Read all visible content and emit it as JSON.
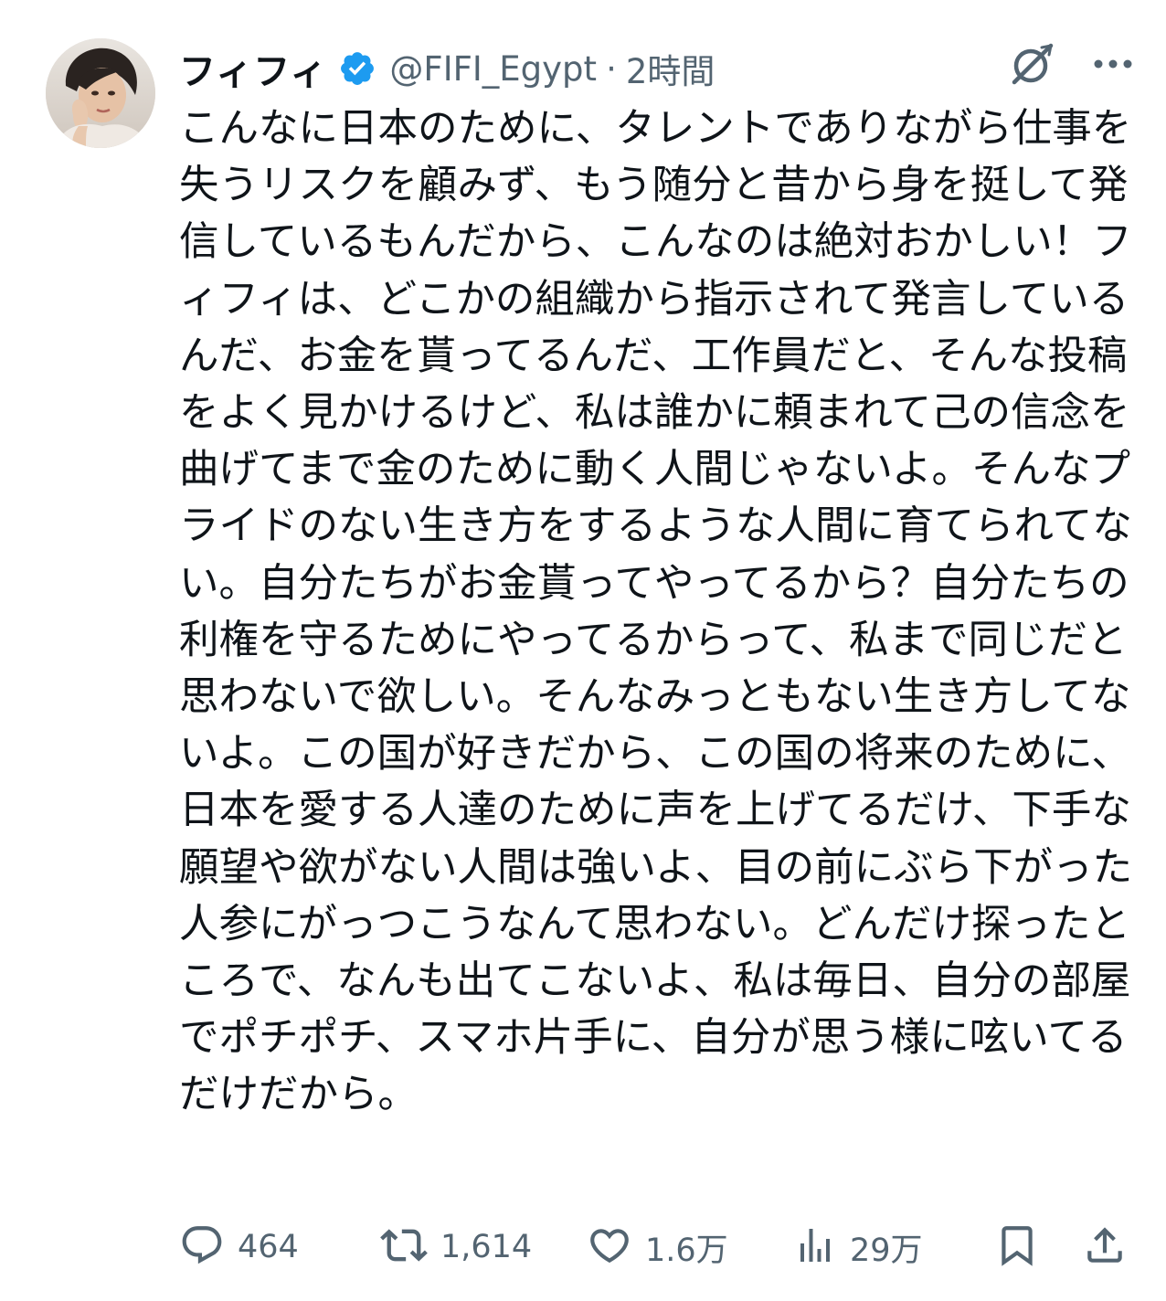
{
  "tweet": {
    "display_name": "フィフィ",
    "handle": "@FIFI_Egypt",
    "separator": "·",
    "timestamp": "2時間",
    "text": "こんなに日本のために、タレントでありながら仕事を失うリスクを顧みず、もう随分と昔から身を挺して発信しているもんだから、こんなのは絶対おかしい！フィフィは、どこかの組織から指示されて発言しているんだ、お金を貰ってるんだ、工作員だと、そんな投稿をよく見かけるけど、私は誰かに頼まれて己の信念を曲げてまで金のために動く人間じゃないよ。そんなプライドのない生き方をするような人間に育てられてない。自分たちがお金貰ってやってるから？自分たちの利権を守るためにやってるからって、私まで同じだと思わないで欲しい。そんなみっともない生き方してないよ。この国が好きだから、この国の将来のために、日本を愛する人達のために声を上げてるだけ、下手な願望や欲がない人間は強いよ、目の前にぶら下がった人参にがっつこうなんて思わない。どんだけ探ったところで、なんも出てこないよ、私は毎日、自分の部屋でポチポチ、スマホ片手に、自分が思う様に呟いてるだけだから。"
  },
  "stats": {
    "replies": "464",
    "retweets": "1,614",
    "likes": "1.6万",
    "views": "29万"
  },
  "icons": {
    "verified": "verified-badge-icon",
    "grok": "grok-icon",
    "more": "more-icon",
    "reply": "reply-icon",
    "retweet": "retweet-icon",
    "like": "heart-icon",
    "views": "views-icon",
    "bookmark": "bookmark-icon",
    "share": "share-icon"
  },
  "colors": {
    "verified_blue": "#1d9bf0",
    "text_primary": "#0f1419",
    "text_secondary": "#536471"
  }
}
